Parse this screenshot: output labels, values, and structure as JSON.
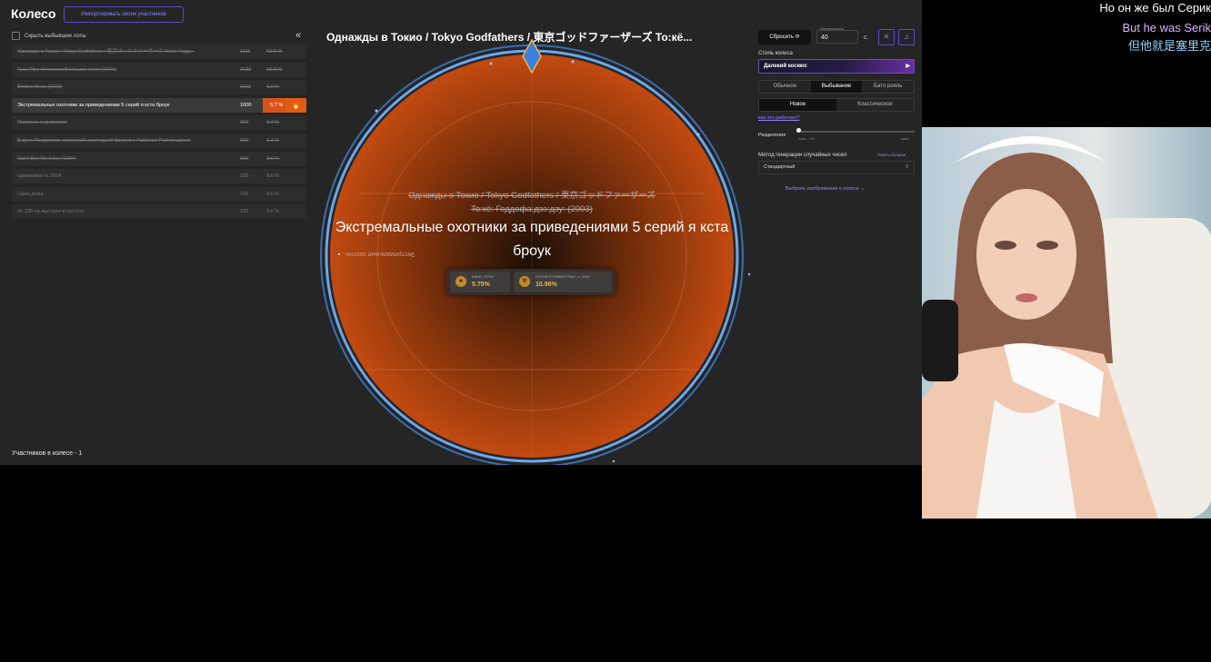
{
  "app": {
    "title": "Колесо",
    "import_button": "Импортировать своих участников",
    "hide_dropped_label": "Скрыть выбывшие лоты",
    "collapse_icon": "«",
    "participants_footer": "Участников в колесе - 1"
  },
  "lots": [
    {
      "name": "Однажды в Токио / Tokyo Godfathers / 東京ゴッドファーザーズ To:кё: Годд...",
      "amount": "1111",
      "percent": "63.5 %",
      "struck": true
    },
    {
      "name": "Гран-При Флоквила/Большие гонки (1975)",
      "amount": "3180",
      "percent": "18.3 %",
      "struck": true
    },
    {
      "name": "Brother Bear (2003)",
      "amount": "1192",
      "percent": "6.9 %",
      "struck": true
    },
    {
      "name": "Экстремальные охотники за приведениями 5 серий я кста броук",
      "amount": "1000",
      "percent": "5.7 %",
      "struck": false,
      "active": true
    },
    {
      "name": "Поплюнь с дьяволом",
      "amount": "250",
      "percent": "1.4 %",
      "struck": true
    },
    {
      "name": "В духе Рождества, классный новогодний фильм с Райаном Рейнольдсом",
      "amount": "200",
      "percent": "1.1 %",
      "struck": true
    },
    {
      "name": "Can't Buy Me Love (1987)",
      "amount": "150",
      "percent": "0.9 %",
      "struck": true
    },
    {
      "name": "одержимость 2014",
      "amount": "100",
      "percent": "0.6 %",
      "struck": false
    },
    {
      "name": "Один дома",
      "amount": "100",
      "percent": "0.6 %",
      "struck": false
    },
    {
      "name": "по 100 на выстрел в пустоту",
      "amount": "100",
      "percent": "0.6 %",
      "struck": false
    }
  ],
  "wheel": {
    "title": "Однажды в Токио / Tokyo Godfathers / 東京ゴッドファーザーズ To:кё...",
    "dropped_text": "Однажды в Токио / Tokyo Godfathers / 東京ゴッドファーザーズ To:кё: Годдофа:дзэ:дзу: (2003)",
    "winner_text": "Экстремальные охотники за приведениями 5 серий я кста броук",
    "mirror_text": "Экстремальные охотни...",
    "chance_label": "ШАНС ЛОТА",
    "chance_value": "5.75%",
    "odds_label": "ЛОТОВ СТОИМОСТЬЮ >= 1000",
    "odds_value": "10.96%",
    "colors": {
      "fill": "#c24a10",
      "ring": "#4a8fd6",
      "accent": "#f1b83c"
    }
  },
  "controls": {
    "reset_button": "Сбросить",
    "duration_label": "Длительность",
    "duration_value": "40",
    "duration_unit": "с.",
    "icon_close": "close-icon",
    "icon_music": "music-icon",
    "style_label": "Стиль колеса",
    "style_value": "Далекий космос",
    "modes": [
      "Обычное",
      "Выбывание",
      "Батл рояль"
    ],
    "active_mode": "Выбывание",
    "types": [
      "Новое",
      "Классическое"
    ],
    "active_type": "Новое",
    "how_link": "как это работает?",
    "split_label": "Разделение",
    "split_min": "макс. / 10",
    "split_max": "макс",
    "split_level": 0,
    "rng_label": "Метод генерации случайных чисел",
    "rng_link": "Узнать больше",
    "rng_value": "Стандартный",
    "image_link": "Выбрать изображение в колесе"
  },
  "subtitles": {
    "ru": "Но он же был Серик",
    "en": "But he was Serik",
    "zh": "但他就是塞里克"
  }
}
